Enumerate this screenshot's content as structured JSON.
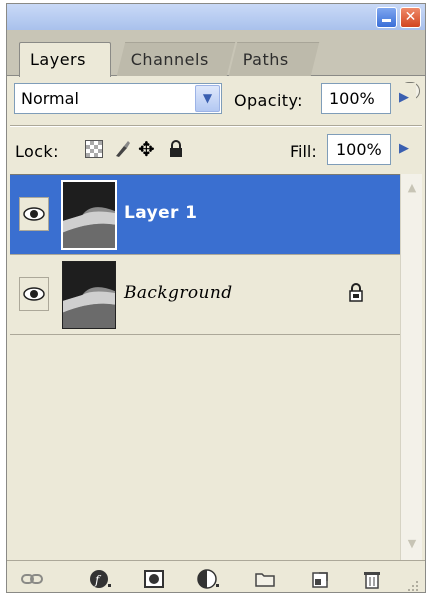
{
  "panel": {
    "tabs": [
      {
        "label": "Layers",
        "active": true
      },
      {
        "label": "Channels",
        "active": false
      },
      {
        "label": "Paths",
        "active": false
      }
    ],
    "menu_icon": "circle-arrow-icon",
    "window_buttons": [
      "minimize-icon",
      "close-icon"
    ]
  },
  "blend": {
    "mode": "Normal",
    "opacity_label": "Opacity:",
    "opacity_value": "100%"
  },
  "lock": {
    "label": "Lock:",
    "icons": [
      "lock-transparent-icon",
      "lock-image-icon",
      "lock-position-icon",
      "lock-all-icon"
    ],
    "fill_label": "Fill:",
    "fill_value": "100%"
  },
  "layers": [
    {
      "name": "Layer 1",
      "visible": true,
      "selected": true,
      "locked": false
    },
    {
      "name": "Background",
      "visible": true,
      "selected": false,
      "locked": true
    }
  ],
  "footer": {
    "icons": [
      "link-icon",
      "fx-icon",
      "mask-icon",
      "adjustment-icon",
      "group-folder-icon",
      "new-layer-icon",
      "trash-icon"
    ]
  },
  "colors": {
    "panel_bg": "#ece9d8",
    "selection": "#3a6fd0",
    "input_border": "#7f9db9"
  }
}
